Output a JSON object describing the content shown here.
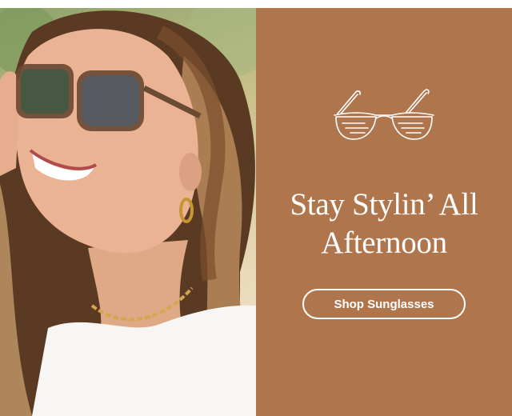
{
  "banner": {
    "headline": "Stay Stylin’ All Afternoon",
    "cta_label": "Shop Sunglasses",
    "icon": "sunglasses-icon",
    "photo": "woman-wearing-sunglasses-photo"
  },
  "colors": {
    "panel_background": "#af764e",
    "text": "#ffffff",
    "button_border": "#ffffff"
  }
}
